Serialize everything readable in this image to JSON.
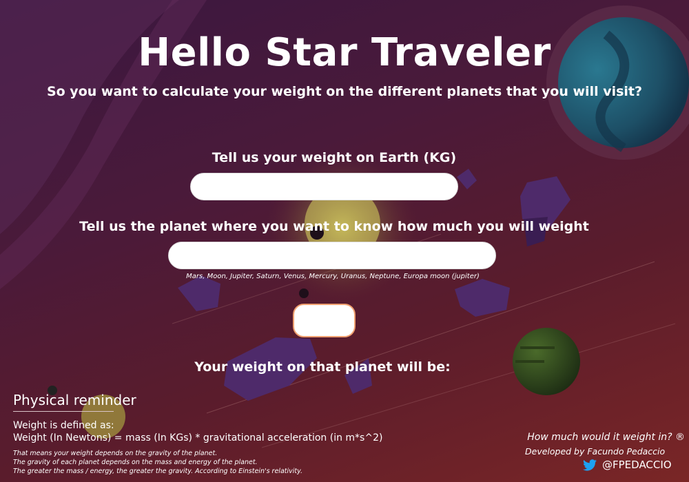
{
  "header": {
    "title": "Hello Star Traveler",
    "subtitle": "So you want to calculate your weight on the different planets that you will visit?"
  },
  "form": {
    "weight_label": "Tell us your weight on Earth (KG)",
    "weight_value": "",
    "planet_label": "Tell us the planet where you want to know how much you will weight",
    "planet_value": "",
    "planet_options_hint": "Mars, Moon, Jupiter, Saturn, Venus, Mercury, Uranus, Neptune,  Europa moon (jupiter)",
    "calculate_button_label": "",
    "result_label": "Your weight on that planet will be:"
  },
  "reminder": {
    "title": "Physical reminder",
    "definition_intro": "Weight is defined as:",
    "formula": "Weight (In Newtons)  = mass (In KGs) * gravitational acceleration (in m*s^2)",
    "notes": [
      "That means your weight depends on the gravity of the planet.",
      "The gravity of each planet depends on the mass and energy of the planet.",
      "The greater the mass / energy, the greater the gravity. According to Einstein's relativity."
    ]
  },
  "footer": {
    "app_name": "How much would it weight in? ®",
    "developer": "Developed by Facundo Pedaccio",
    "twitter_handle": "@FPEDACCIO",
    "twitter_icon": "twitter-bird-icon"
  },
  "colors": {
    "background_top": "#3a1740",
    "background_bottom": "#7a2626",
    "accent_border": "#f0a070",
    "twitter_blue": "#1da1f2"
  }
}
